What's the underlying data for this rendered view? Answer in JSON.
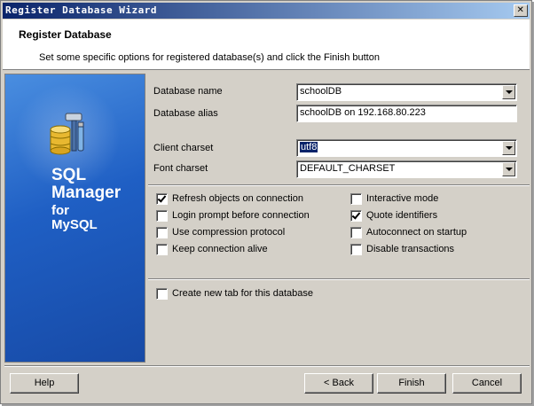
{
  "window": {
    "title": "Register Database Wizard",
    "close_glyph": "✕"
  },
  "header": {
    "title": "Register Database",
    "subtitle": "Set some specific options for registered database(s) and click the Finish button"
  },
  "sidebar": {
    "line1": "SQL",
    "line2": "Manager",
    "line3": "for",
    "line4": "MySQL",
    "icon": "database-tools-icon"
  },
  "form": {
    "database_name": {
      "label": "Database name",
      "value": "schoolDB"
    },
    "database_alias": {
      "label": "Database alias",
      "value": "schoolDB on 192.168.80.223"
    },
    "client_charset": {
      "label": "Client charset",
      "value": "utf8"
    },
    "font_charset": {
      "label": "Font charset",
      "value": "DEFAULT_CHARSET"
    }
  },
  "options_left": [
    {
      "label": "Refresh objects on connection",
      "checked": true
    },
    {
      "label": "Login prompt before connection",
      "checked": false
    },
    {
      "label": "Use compression protocol",
      "checked": false
    },
    {
      "label": "Keep connection alive",
      "checked": false
    }
  ],
  "options_right": [
    {
      "label": "Interactive mode",
      "checked": false
    },
    {
      "label": "Quote identifiers",
      "checked": true
    },
    {
      "label": "Autoconnect on startup",
      "checked": false
    },
    {
      "label": "Disable transactions",
      "checked": false
    }
  ],
  "new_tab_option": {
    "label": "Create new tab for this database",
    "checked": false
  },
  "buttons": {
    "help": "Help",
    "back": "< Back",
    "finish": "Finish",
    "cancel": "Cancel"
  },
  "colors": {
    "titlebar_start": "#0a246a",
    "titlebar_end": "#a6caf0",
    "sidebar": "#1f5fc4",
    "dialog": "#d4d0c8"
  }
}
